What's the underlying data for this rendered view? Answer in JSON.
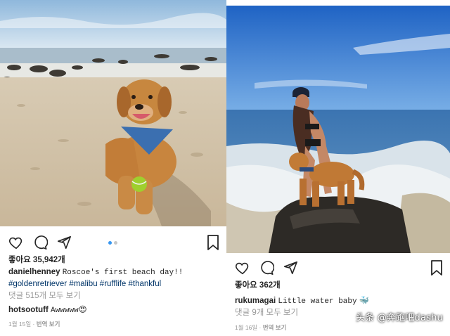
{
  "left_post": {
    "likes": "좋아요 35,942개",
    "username": "danielhenney",
    "caption": "Roscoe's first beach day!!",
    "hashtags": [
      "#goldenretriever",
      "#malibu",
      "#rufflife",
      "#thankful"
    ],
    "comments_link": "댓글 515개 모두 보기",
    "comment": {
      "username": "hotsootuff",
      "text": "Awwwww",
      "emoji": "😍"
    },
    "date": "1월 15일",
    "translate": "번역 보기",
    "carousel": {
      "count": 2,
      "active": 1
    }
  },
  "right_post": {
    "likes": "좋아요 362개",
    "username": "rukumagai",
    "caption": "Little water baby",
    "emoji": "🐳",
    "comments_link": "댓글 9개 모두 보기",
    "date": "1월 16일",
    "translate": "번역 보기"
  },
  "icons": [
    "heart-icon",
    "comment-icon",
    "share-icon",
    "bookmark-icon"
  ],
  "watermark": "头条 @奔跑吧dashu",
  "colors": {
    "hashtag": "#003569",
    "muted": "#999999",
    "carousel_active": "#3897f0"
  }
}
